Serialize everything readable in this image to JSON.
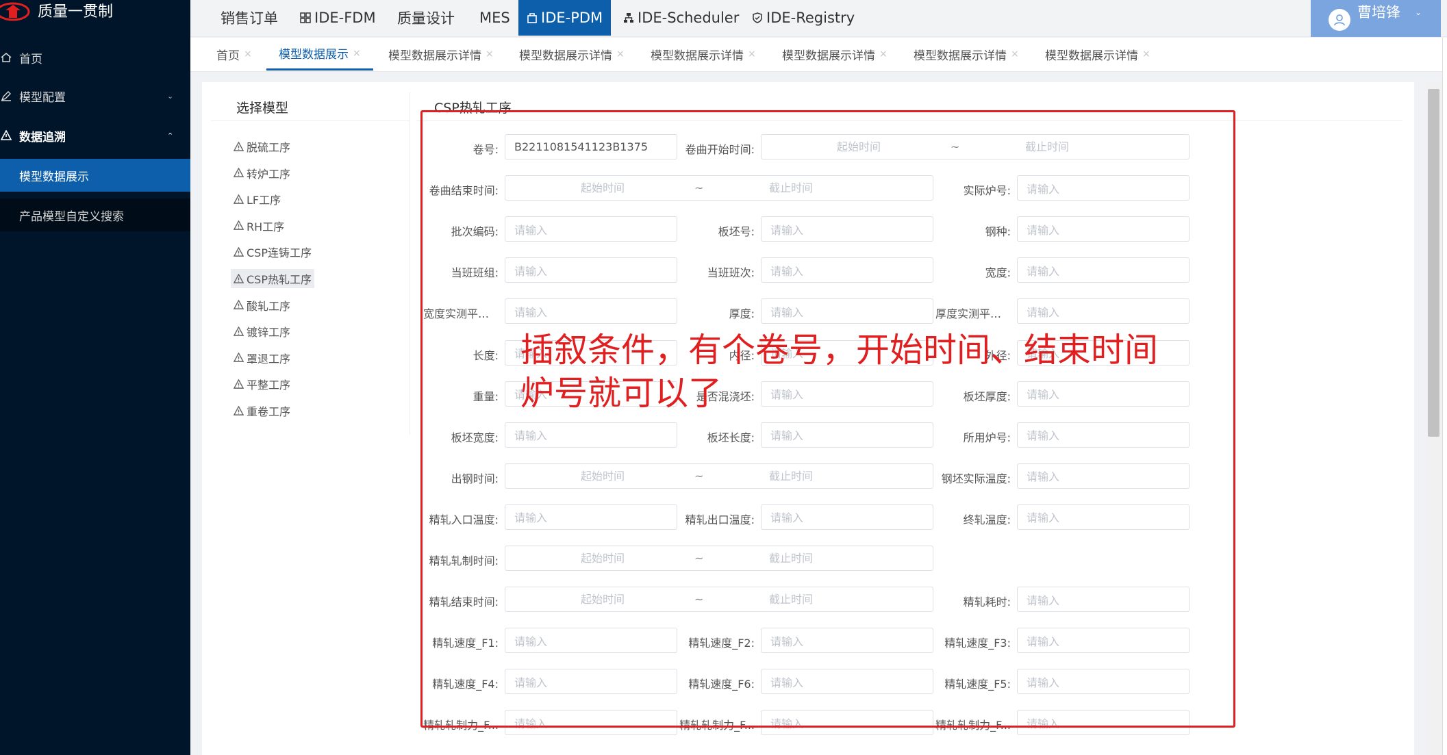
{
  "brand": {
    "name": "质量一贯制"
  },
  "sidebar": {
    "items": [
      {
        "label": "首页",
        "icon": "home-icon"
      },
      {
        "label": "模型配置",
        "icon": "edit-icon"
      },
      {
        "label": "数据追溯",
        "icon": "warning-icon"
      }
    ],
    "sub_items": [
      {
        "label": "模型数据展示",
        "active": true
      },
      {
        "label": "产品模型自定义搜索",
        "active": false
      }
    ]
  },
  "topnav": {
    "items": [
      {
        "label": "销售订单"
      },
      {
        "label": "IDE-FDM",
        "icon": "grid-icon"
      },
      {
        "label": "质量设计"
      },
      {
        "label": "MES"
      },
      {
        "label": "IDE-PDM",
        "icon": "bag-icon",
        "active": true
      },
      {
        "label": "IDE-Scheduler",
        "icon": "sitemap-icon"
      },
      {
        "label": "IDE-Registry",
        "icon": "shield-icon"
      }
    ],
    "user": "曹培锋"
  },
  "tabs": [
    {
      "label": "首页"
    },
    {
      "label": "模型数据展示",
      "active": true
    },
    {
      "label": "模型数据展示详情"
    },
    {
      "label": "模型数据展示详情"
    },
    {
      "label": "模型数据展示详情"
    },
    {
      "label": "模型数据展示详情"
    },
    {
      "label": "模型数据展示详情"
    },
    {
      "label": "模型数据展示详情"
    }
  ],
  "model_panel": {
    "title": "选择模型",
    "items": [
      "脱硫工序",
      "转炉工序",
      "LF工序",
      "RH工序",
      "CSP连铸工序",
      "CSP热轧工序",
      "酸轧工序",
      "镀锌工序",
      "罩退工序",
      "平整工序",
      "重卷工序"
    ],
    "selected": "CSP热轧工序"
  },
  "form": {
    "title": "CSP热轧工序",
    "placeholder": "请输入",
    "range_start": "起始时间",
    "range_sep": "~",
    "range_end": "截止时间",
    "fields": [
      {
        "label": "卷号:",
        "value": "B2211081541123B1375"
      },
      {
        "label": "卷曲开始时间:"
      },
      {
        "label": "卷曲结束时间:"
      },
      {
        "label": "实际炉号:"
      },
      {
        "label": "批次编码:"
      },
      {
        "label": "板坯号:"
      },
      {
        "label": "钢种:"
      },
      {
        "label": "当班班组:"
      },
      {
        "label": "当班班次:"
      },
      {
        "label": "宽度:"
      },
      {
        "label": "宽度实测平均..."
      },
      {
        "label": "厚度:"
      },
      {
        "label": "厚度实测平均..."
      },
      {
        "label": "长度:"
      },
      {
        "label": "内径:"
      },
      {
        "label": "外径:"
      },
      {
        "label": "重量:"
      },
      {
        "label": "是否混浇坯:"
      },
      {
        "label": "板坯厚度:"
      },
      {
        "label": "板坯宽度:"
      },
      {
        "label": "板坯长度:"
      },
      {
        "label": "所用炉号:"
      },
      {
        "label": "出钢时间:"
      },
      {
        "label": "钢坯实际温度:"
      },
      {
        "label": "精轧入口温度:"
      },
      {
        "label": "精轧出口温度:"
      },
      {
        "label": "终轧温度:"
      },
      {
        "label": "精轧轧制时间:"
      },
      {
        "label": "精轧结束时间:"
      },
      {
        "label": "精轧耗时:"
      },
      {
        "label": "精轧速度_F1:"
      },
      {
        "label": "精轧速度_F2:"
      },
      {
        "label": "精轧速度_F3:"
      },
      {
        "label": "精轧速度_F4:"
      },
      {
        "label": "精轧速度_F6:"
      },
      {
        "label": "精轧速度_F5:"
      },
      {
        "label": "精轧轧制力_F..."
      },
      {
        "label": "精轧轧制力_F..."
      },
      {
        "label": "精轧轧制力_F..."
      }
    ]
  },
  "annotation": {
    "line1": "插叙条件，有个卷号，开始时间、结束时间",
    "line2": "炉号就可以了",
    "color": "#e02020"
  },
  "colors": {
    "sidebar": "#001529",
    "accent": "#0d5eab",
    "user_box": "#7aa5de"
  }
}
